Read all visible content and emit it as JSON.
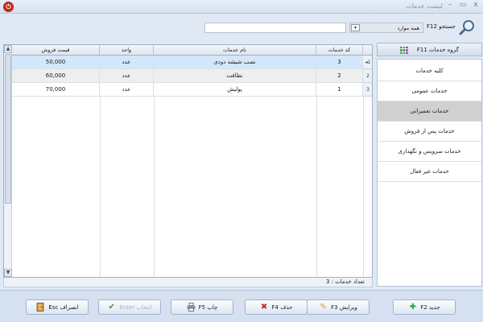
{
  "window": {
    "title": "لیست خدمات",
    "minimize_glyph": "–",
    "restore_glyph": "▭",
    "close_glyph": "x",
    "app_glyph": "⏻"
  },
  "search": {
    "label": "جستجو F12",
    "scope_value": "همه موارد",
    "dropdown_glyph": "▾",
    "placeholder": ""
  },
  "sidebar": {
    "header_label": "گروه خدمات F11",
    "items": [
      {
        "label": "کلیه خدمات",
        "active": false
      },
      {
        "label": "خدمات عمومی",
        "active": false
      },
      {
        "label": "خدمات تعمیراتی",
        "active": true
      },
      {
        "label": "خدمات پس از فروش",
        "active": false
      },
      {
        "label": "خدمات سرویس و نگهداری",
        "active": false
      },
      {
        "label": "خدمات غیر فعال",
        "active": false
      }
    ]
  },
  "grid": {
    "columns": {
      "code": "کد خدمات",
      "name": "نام خدمات",
      "unit": "واحد",
      "price": "قیمت فروش"
    },
    "rows": [
      {
        "num": "1",
        "code": "3",
        "name": "نصب شیشه دودی",
        "unit": "عدد",
        "price": "50,000",
        "selected": true
      },
      {
        "num": "2",
        "code": "2",
        "name": "نظافت",
        "unit": "عدد",
        "price": "60,000",
        "selected": false
      },
      {
        "num": "3",
        "code": "1",
        "name": "پولیش",
        "unit": "عدد",
        "price": "70,000",
        "selected": false
      }
    ],
    "count_label": "تعداد خدمات : 3"
  },
  "toolbar": {
    "new_label": "جدید F2",
    "edit_label": "ویرایش F3",
    "delete_label": "حذف F4",
    "print_label": "چاپ F5",
    "select_label": "انتخاب Enter",
    "cancel_label": "انصراف Esc"
  },
  "colors": {
    "selected_row": "#d4e7fa",
    "alt_row": "#eeeeee",
    "active_group": "#d0d0d0",
    "toolbar_bg": "#d5e1f0"
  }
}
